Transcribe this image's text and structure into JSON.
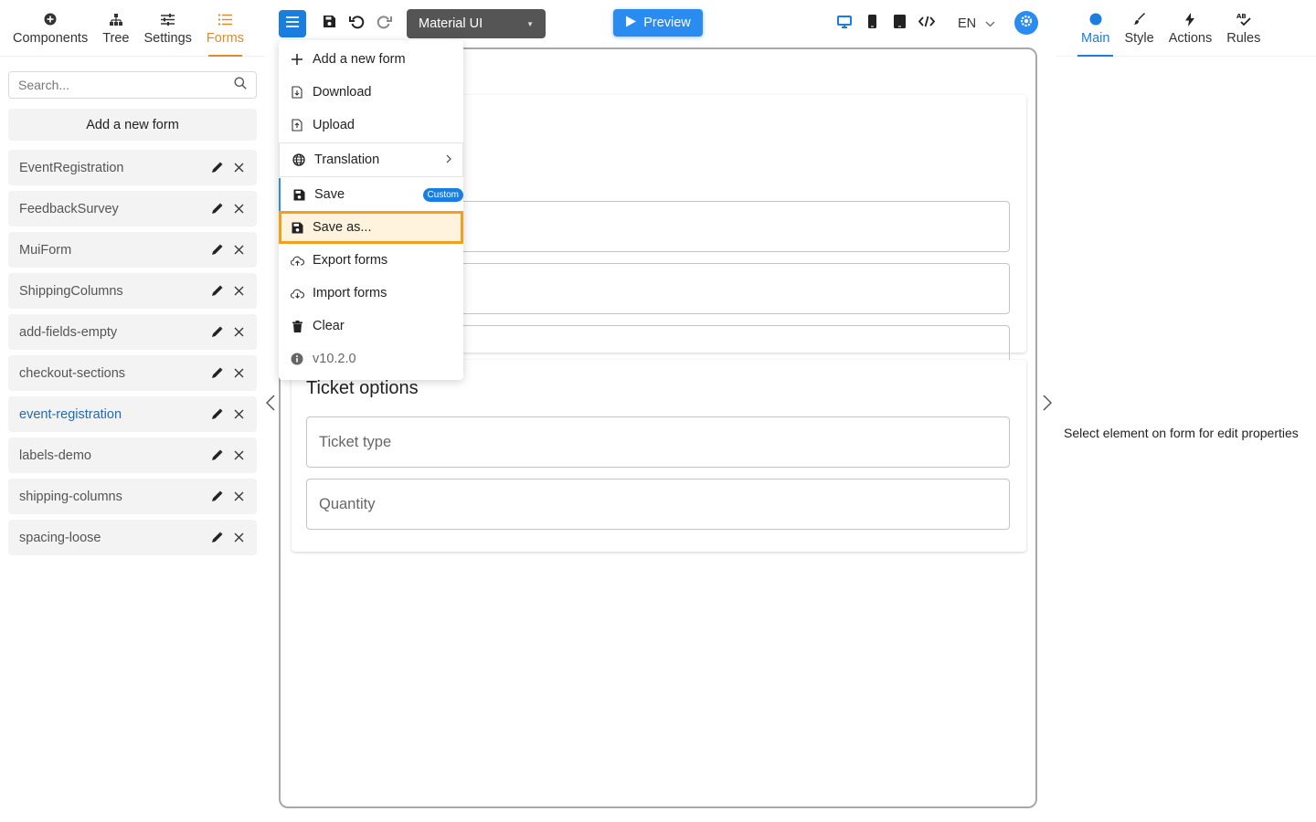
{
  "left_tabs": [
    {
      "label": "Components",
      "icon": "plus-circle-icon"
    },
    {
      "label": "Tree",
      "icon": "sitemap-icon"
    },
    {
      "label": "Settings",
      "icon": "sliders-icon"
    },
    {
      "label": "Forms",
      "icon": "list-icon",
      "active": true
    }
  ],
  "search": {
    "placeholder": "Search..."
  },
  "add_form_label": "Add a new form",
  "forms": [
    {
      "name": "EventRegistration"
    },
    {
      "name": "FeedbackSurvey"
    },
    {
      "name": "MuiForm"
    },
    {
      "name": "ShippingColumns"
    },
    {
      "name": "add-fields-empty"
    },
    {
      "name": "checkout-sections"
    },
    {
      "name": "event-registration",
      "selected": true
    },
    {
      "name": "labels-demo"
    },
    {
      "name": "shipping-columns"
    },
    {
      "name": "spacing-loose"
    }
  ],
  "toolbar": {
    "theme": "Material UI",
    "preview_label": "Preview",
    "language": "EN"
  },
  "menu": {
    "items": [
      {
        "label": "Add a new form",
        "icon": "plus-icon"
      },
      {
        "label": "Download",
        "icon": "file-download-icon"
      },
      {
        "label": "Upload",
        "icon": "file-upload-icon"
      },
      {
        "label": "Translation",
        "icon": "globe-icon"
      },
      {
        "label": "Save",
        "icon": "floppy-icon",
        "badge": "Custom"
      },
      {
        "label": "Save as...",
        "icon": "floppy-icon"
      },
      {
        "label": "Export forms",
        "icon": "cloud-upload-icon"
      },
      {
        "label": "Import forms",
        "icon": "cloud-download-icon"
      },
      {
        "label": "Clear",
        "icon": "trash-icon"
      },
      {
        "label": "v10.2.0",
        "icon": "info-icon"
      }
    ]
  },
  "canvas": {
    "card2_title": "Ticket options",
    "fields": [
      "Ticket type",
      "Quantity"
    ]
  },
  "right_tabs": [
    {
      "label": "Main",
      "icon": "dot-icon",
      "active": true
    },
    {
      "label": "Style",
      "icon": "brush-icon"
    },
    {
      "label": "Actions",
      "icon": "bolt-icon"
    },
    {
      "label": "Rules",
      "icon": "rules-icon"
    }
  ],
  "properties_message": "Select element on form for edit properties",
  "colors": {
    "accent_orange": "#e08a2c",
    "accent_blue": "#1a7ee0",
    "highlight": "#f0a020"
  }
}
